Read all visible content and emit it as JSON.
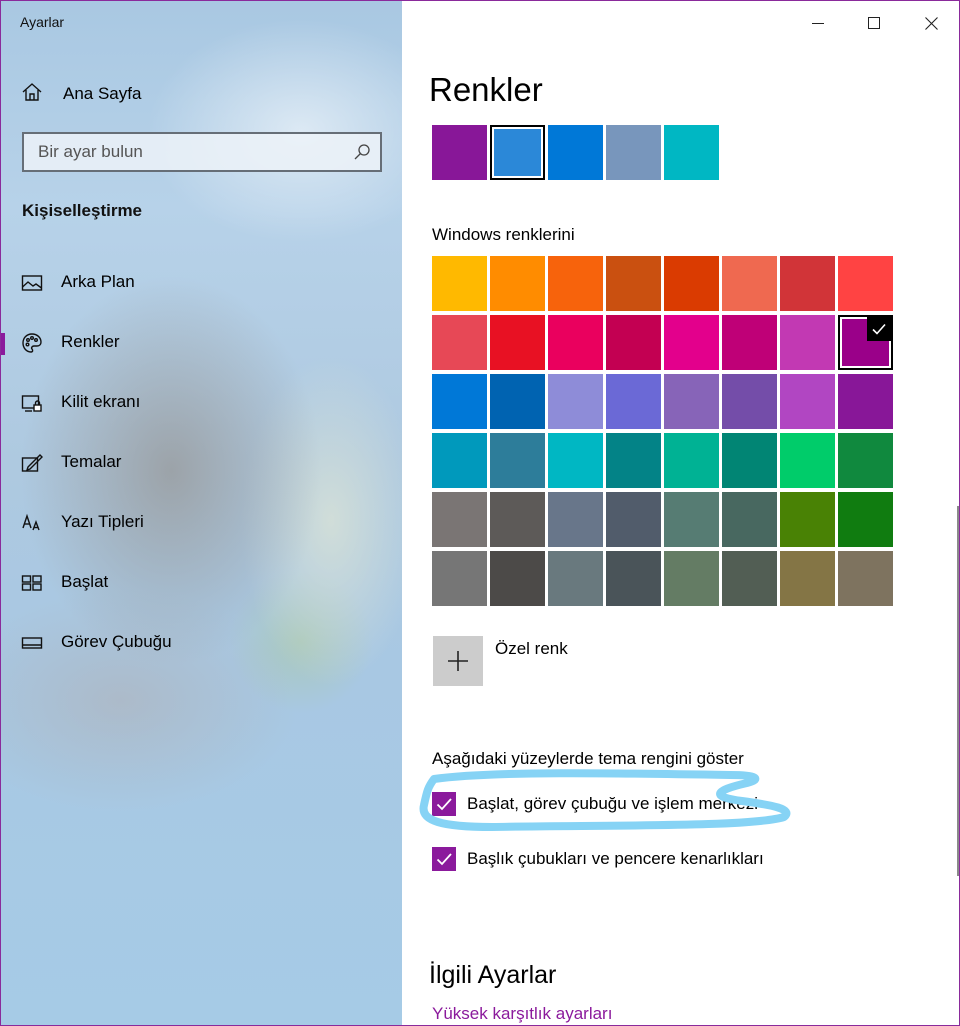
{
  "window": {
    "title": "Ayarlar"
  },
  "sidebar": {
    "home_label": "Ana Sayfa",
    "search_placeholder": "Bir ayar bulun",
    "section_title": "Kişiselleştirme",
    "items": [
      {
        "label": "Arka Plan",
        "icon": "picture-icon"
      },
      {
        "label": "Renkler",
        "icon": "palette-icon",
        "active": true
      },
      {
        "label": "Kilit ekranı",
        "icon": "lock-screen-icon"
      },
      {
        "label": "Temalar",
        "icon": "themes-icon"
      },
      {
        "label": "Yazı Tipleri",
        "icon": "fonts-icon"
      },
      {
        "label": "Başlat",
        "icon": "start-icon"
      },
      {
        "label": "Görev Çubuğu",
        "icon": "taskbar-icon"
      }
    ]
  },
  "main": {
    "title": "Renkler",
    "recent_colors": [
      "#881798",
      "#2b88d8",
      "#0078d7",
      "#7896bc",
      "#00b7c3"
    ],
    "recent_selected_index": 1,
    "windows_colors_label": "Windows renklerini",
    "windows_colors": [
      "#ffb900",
      "#ff8c00",
      "#f7630c",
      "#ca5010",
      "#da3b01",
      "#ef6950",
      "#d13438",
      "#ff4343",
      "#e74856",
      "#e81123",
      "#ea005e",
      "#c30052",
      "#e3008c",
      "#bf0077",
      "#c239b3",
      "#9a0089",
      "#0078d7",
      "#0063b1",
      "#8e8cd8",
      "#6b69d6",
      "#8764b8",
      "#744da9",
      "#b146c2",
      "#881798",
      "#0099bc",
      "#2d7d9a",
      "#00b7c3",
      "#038387",
      "#00b294",
      "#018574",
      "#00cc6a",
      "#10893e",
      "#7a7574",
      "#5d5a58",
      "#68768a",
      "#515c6b",
      "#567c73",
      "#486860",
      "#498205",
      "#107c10",
      "#767676",
      "#4c4a48",
      "#69797e",
      "#4a5459",
      "#647c64",
      "#525e54",
      "#847545",
      "#7e735f"
    ],
    "selected_color_index": 15,
    "custom_color_label": "Özel renk",
    "surfaces_title": "Aşağıdaki yüzeylerde tema rengini göster",
    "checkboxes": [
      {
        "label": "Başlat, görev çubuğu ve işlem merkezi",
        "checked": true
      },
      {
        "label": "Başlık çubukları ve pencere kenarlıkları",
        "checked": true
      }
    ],
    "related_title": "İlgili Ayarlar",
    "related_link": "Yüksek karşıtlık ayarları"
  },
  "colors": {
    "accent": "#8b1a9c",
    "highlight_marker": "#86d3f5"
  }
}
